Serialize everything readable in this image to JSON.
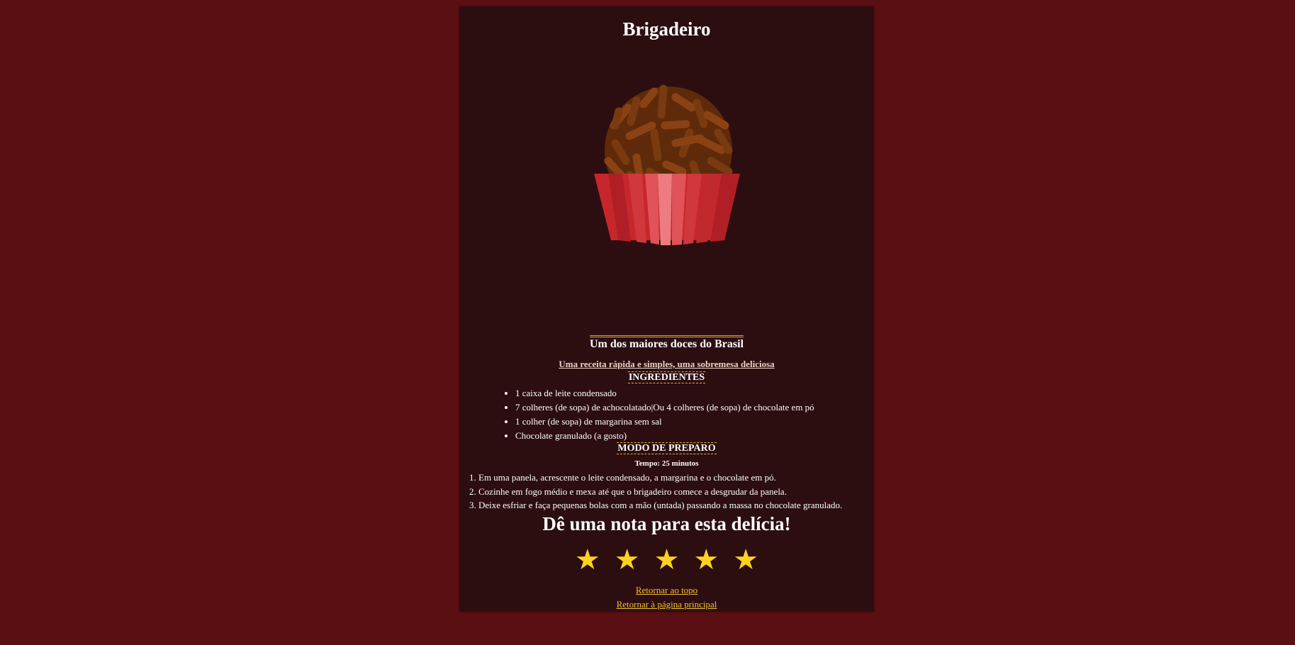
{
  "recipe": {
    "title": "Brigadeiro",
    "subtitle": "Um dos maiores doces do Brasil",
    "tagline": "Uma receita rápida e simples, uma sobremesa deliciosa"
  },
  "ingredients": {
    "title": "INGREDIENTES",
    "items": [
      "1 caixa de leite condensado",
      "7 colheres (de sopa) de achocolatado|Ou 4 colheres (de sopa) de chocolate em pó",
      "1 colher (de sopa) de margarina sem sal",
      "Chocolate granulado (a gosto)"
    ]
  },
  "preparation": {
    "title": "MODO DE PREPARO",
    "time": "Tempo: 25 minutos",
    "steps": [
      "1. Em uma panela, acrescente o leite condensado, a margarina e o chocolate em pó.",
      "2. Cozinhe em fogo médio e mexa até que o brigadeiro comece a desgrudar da panela.",
      "3. Deixe esfriar e faça pequenas bolas com a mão (untada) passando a massa no chocolate granulado."
    ]
  },
  "rating": {
    "heading": "Dê uma nota para esta delícia!",
    "stars": [
      "★",
      "★",
      "★",
      "★",
      "★"
    ],
    "star_color": "#ffd21f"
  },
  "links": {
    "top": "Retornar ao topo",
    "home": "Retornar à página principal"
  },
  "colors": {
    "page_background": "#5a0f12",
    "card_background": "#2c0e10",
    "accent": "#f5c02c"
  },
  "illustration": {
    "icon": "brigadeiro-icon"
  }
}
